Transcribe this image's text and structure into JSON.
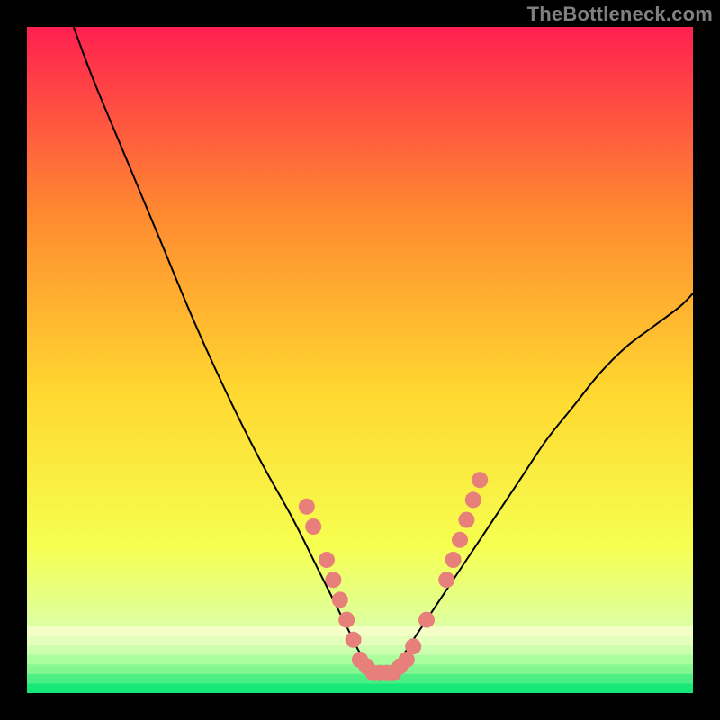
{
  "watermark": "TheBottleneck.com",
  "chart_data": {
    "type": "line",
    "title": "",
    "xlabel": "",
    "ylabel": "",
    "xlim": [
      0,
      100
    ],
    "ylim": [
      0,
      100
    ],
    "background_gradient": {
      "top": "#ff2050",
      "upper_mid": "#ff8a30",
      "mid": "#ffd830",
      "lower_mid": "#f6ff50",
      "lower": "#d8ffb0",
      "bottom": "#00e878"
    },
    "curve": {
      "description": "V-shaped bottleneck curve; minimum near x≈52, y≈3; left branch rises to top-left near x≈7,y≈100; right branch rises to x≈100,y≈60",
      "x": [
        7,
        10,
        15,
        20,
        25,
        30,
        35,
        40,
        44,
        48,
        50,
        52,
        54,
        56,
        58,
        62,
        66,
        70,
        74,
        78,
        82,
        86,
        90,
        94,
        98,
        100
      ],
      "y": [
        100,
        92,
        80,
        68,
        56,
        45,
        35,
        26,
        18,
        10,
        6,
        3,
        3,
        5,
        8,
        14,
        20,
        26,
        32,
        38,
        43,
        48,
        52,
        55,
        58,
        60
      ]
    },
    "markers": {
      "color": "#e77f7a",
      "description": "Thick salmon dots clustered along the bottom of the V and partway up both branches",
      "points": [
        {
          "x": 42,
          "y": 28
        },
        {
          "x": 43,
          "y": 25
        },
        {
          "x": 45,
          "y": 20
        },
        {
          "x": 46,
          "y": 17
        },
        {
          "x": 47,
          "y": 14
        },
        {
          "x": 48,
          "y": 11
        },
        {
          "x": 49,
          "y": 8
        },
        {
          "x": 50,
          "y": 5
        },
        {
          "x": 51,
          "y": 4
        },
        {
          "x": 52,
          "y": 3
        },
        {
          "x": 53,
          "y": 3
        },
        {
          "x": 54,
          "y": 3
        },
        {
          "x": 55,
          "y": 3
        },
        {
          "x": 56,
          "y": 4
        },
        {
          "x": 57,
          "y": 5
        },
        {
          "x": 58,
          "y": 7
        },
        {
          "x": 60,
          "y": 11
        },
        {
          "x": 63,
          "y": 17
        },
        {
          "x": 64,
          "y": 20
        },
        {
          "x": 65,
          "y": 23
        },
        {
          "x": 66,
          "y": 26
        },
        {
          "x": 67,
          "y": 29
        },
        {
          "x": 68,
          "y": 32
        }
      ]
    },
    "bottom_band": {
      "description": "Horizontal striping/band between y≈0 and y≈10 transitioning from yellow to green",
      "y_top": 10,
      "y_bottom": 0
    }
  }
}
